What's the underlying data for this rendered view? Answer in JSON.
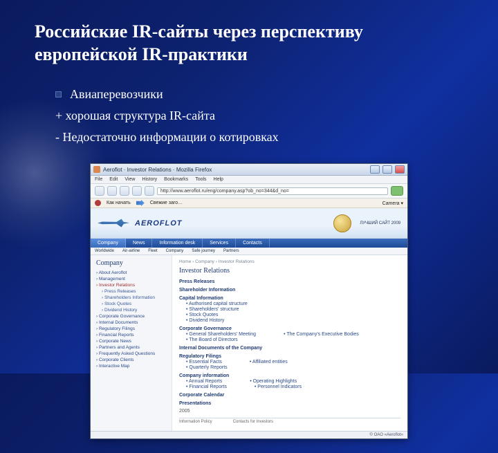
{
  "slide": {
    "title": "Российские IR-сайты через перспективу европейской IR-практики",
    "bullet": "Авиаперевозчики",
    "plus": "+ хорошая структура IR-сайта",
    "minus": "- Недостаточно информации о котировках"
  },
  "browser": {
    "title": "Aeroflot · Investor Relations · Mozilla Firefox",
    "menus": [
      "File",
      "Edit",
      "View",
      "History",
      "Bookmarks",
      "Tools",
      "Help"
    ],
    "address": "http://www.aeroflot.ru/eng/company.asp?ob_no=344&d_no=",
    "linkbar_left": "Как начать",
    "linkbar_right": "Свежие заго…",
    "camera": "Camera ▾"
  },
  "page": {
    "brand": "AEROFLOT",
    "medal_label": "ЛУЧШИЙ САЙТ 2009",
    "topnav": [
      "Company",
      "News",
      "Information desk",
      "Services",
      "Contacts"
    ],
    "subnav": [
      "Worldwide",
      "Air-airline",
      "Fleet",
      "Company",
      "Safe journey",
      "Partners"
    ],
    "breadcrumb": "Home  ›  Company  ›  Investor Relations",
    "section_title": "Investor Relations",
    "sidebar_head": "Company",
    "sidebar": [
      {
        "t": "About Aeroflot"
      },
      {
        "t": "Management"
      },
      {
        "t": "Investor Relations",
        "cur": true
      },
      {
        "t": "Press Releases",
        "sub": true
      },
      {
        "t": "Shareholders Information",
        "sub": true
      },
      {
        "t": "Stock Quotes",
        "sub": true
      },
      {
        "t": "Dividend History",
        "sub": true
      },
      {
        "t": "Corporate Governance"
      },
      {
        "t": "Internal Documents"
      },
      {
        "t": "Regulatory Filings"
      },
      {
        "t": "Financial Reports"
      },
      {
        "t": "Corporate News"
      },
      {
        "t": "Partners and Agents"
      },
      {
        "t": "Frequently Asked Questions"
      },
      {
        "t": "Corporate Clients"
      },
      {
        "t": "Interactive Map"
      }
    ],
    "main": {
      "items": [
        {
          "h": "Press Releases"
        },
        {
          "h": "Shareholder Information"
        },
        {
          "h": "Capital Information"
        },
        {
          "t": "Authorised capital structure",
          "sub": true
        },
        {
          "t": "Shareholders' structure",
          "sub": true
        },
        {
          "t": "Stock Quotes",
          "sub": true
        },
        {
          "t": "Dividend History",
          "sub": true
        },
        {
          "h": "Corporate Governance"
        },
        {
          "t": "General Shareholders' Meeting",
          "sub": true,
          "r": "The Company's Executive Bodies"
        },
        {
          "t": "The Board of Directors",
          "sub": true
        },
        {
          "h": "Internal Documents of the Company"
        },
        {
          "h": "Regulatory Filings"
        },
        {
          "t": "Essential Facts",
          "sub": true,
          "r": "Affiliated entities"
        },
        {
          "t": "Quarterly Reports",
          "sub": true
        },
        {
          "h": "Company information"
        },
        {
          "t": "Annual Reports",
          "sub": true,
          "r": "Operating Highlights"
        },
        {
          "t": "Financial Reports",
          "sub": true,
          "r": "Personnel Indicators"
        },
        {
          "h": "Corporate Calendar"
        },
        {
          "h": "Presentations"
        }
      ],
      "years": "2005",
      "info_left": "Information Policy",
      "info_right": "Contacts for Investors"
    },
    "status": "© OAO «Aeroflot»"
  }
}
